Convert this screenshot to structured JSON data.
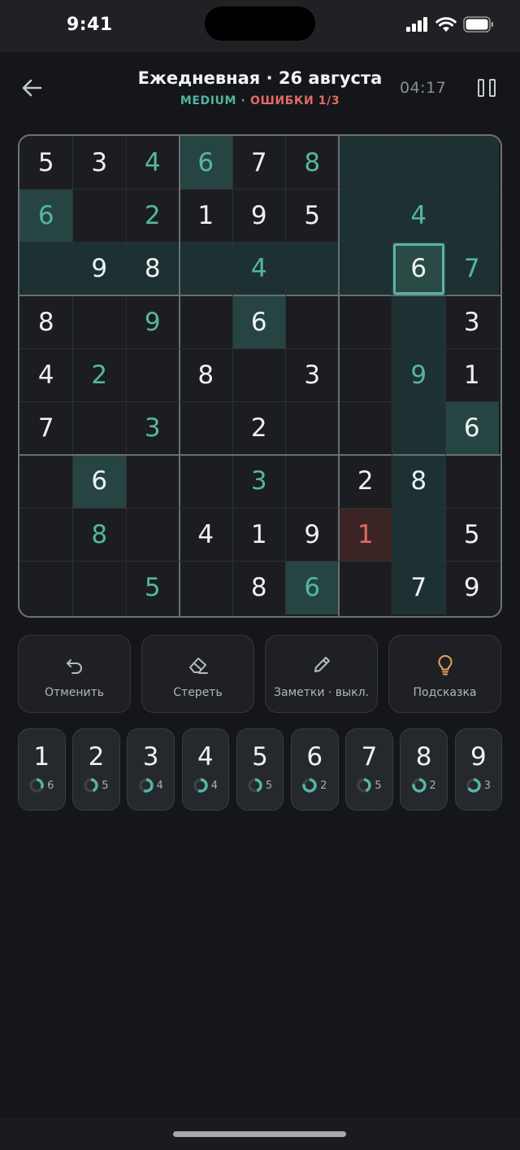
{
  "status_bar": {
    "time": "9:41"
  },
  "header": {
    "title": "Ежедневная · 26 августа",
    "level": "MEDIUM",
    "separator": "·",
    "errors": "ОШИБКИ 1/3",
    "timer": "04:17"
  },
  "board": {
    "rows": [
      [
        "5",
        "3",
        "4",
        "6",
        "7",
        "8",
        "",
        "",
        ""
      ],
      [
        "6",
        "",
        "2",
        "1",
        "9",
        "5",
        "",
        "4",
        ""
      ],
      [
        "",
        "9",
        "8",
        "",
        "4",
        "",
        "",
        "6",
        "7"
      ],
      [
        "8",
        "",
        "9",
        "",
        "6",
        "",
        "",
        "",
        "3"
      ],
      [
        "4",
        "2",
        "",
        "8",
        "",
        "3",
        "",
        "9",
        "1"
      ],
      [
        "7",
        "",
        "3",
        "",
        "2",
        "",
        "",
        "",
        "6"
      ],
      [
        "",
        "6",
        "",
        "",
        "3",
        "",
        "2",
        "8",
        ""
      ],
      [
        "",
        "8",
        "",
        "4",
        "1",
        "9",
        "1",
        "",
        "5"
      ],
      [
        "",
        "",
        "5",
        "",
        "8",
        "6",
        "",
        "7",
        "9"
      ]
    ],
    "kinds": [
      [
        "g",
        "g",
        "u",
        "u",
        "g",
        "u",
        "",
        "",
        ""
      ],
      [
        "u",
        "",
        "u",
        "g",
        "g",
        "g",
        "",
        "u",
        ""
      ],
      [
        "",
        "g",
        "g",
        "",
        "u",
        "",
        "",
        "g",
        "u"
      ],
      [
        "g",
        "",
        "u",
        "",
        "g",
        "",
        "",
        "",
        "g"
      ],
      [
        "g",
        "u",
        "",
        "g",
        "",
        "g",
        "",
        "u",
        "g"
      ],
      [
        "g",
        "",
        "u",
        "",
        "g",
        "",
        "",
        "",
        "g"
      ],
      [
        "",
        "g",
        "",
        "",
        "u",
        "",
        "g",
        "g",
        ""
      ],
      [
        "",
        "u",
        "",
        "g",
        "g",
        "g",
        "e",
        "",
        "5"
      ],
      [
        "",
        "",
        "u",
        "",
        "g",
        "u",
        "",
        "g",
        "g"
      ]
    ],
    "selected": [
      2,
      7
    ],
    "error_cell": [
      7,
      6
    ],
    "colors": {
      "given": "#eef0f2",
      "user": "#54b6a2",
      "error": "#e26866",
      "accent": "#57b5a2"
    }
  },
  "tools": [
    {
      "label": "Отменить",
      "icon": "undo-icon"
    },
    {
      "label": "Стереть",
      "icon": "eraser-icon"
    },
    {
      "label": "Заметки · выкл.",
      "icon": "pencil-icon"
    },
    {
      "label": "Подсказка",
      "icon": "lightbulb-icon"
    }
  ],
  "numpad": [
    {
      "digit": "1",
      "remaining": "6",
      "progress": 0.33
    },
    {
      "digit": "2",
      "remaining": "5",
      "progress": 0.44
    },
    {
      "digit": "3",
      "remaining": "4",
      "progress": 0.56
    },
    {
      "digit": "4",
      "remaining": "4",
      "progress": 0.56
    },
    {
      "digit": "5",
      "remaining": "5",
      "progress": 0.44
    },
    {
      "digit": "6",
      "remaining": "2",
      "progress": 0.78
    },
    {
      "digit": "7",
      "remaining": "5",
      "progress": 0.44
    },
    {
      "digit": "8",
      "remaining": "2",
      "progress": 0.78
    },
    {
      "digit": "9",
      "remaining": "3",
      "progress": 0.67
    }
  ]
}
